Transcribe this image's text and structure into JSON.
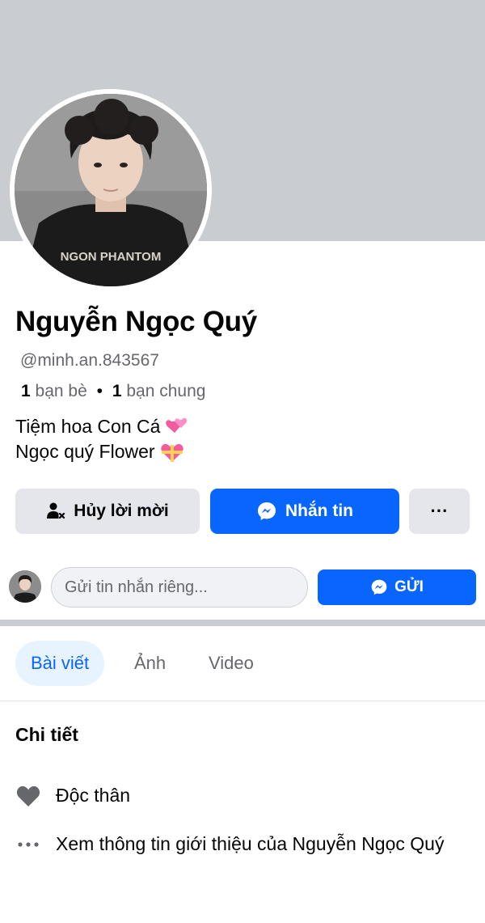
{
  "profile": {
    "name": "Nguyễn Ngọc Quý",
    "handle": "@minh.an.843567",
    "friends_count": "1",
    "friends_label": "bạn bè",
    "separator": "•",
    "mutual_count": "1",
    "mutual_label": "bạn chung",
    "bio_line1": "Tiệm hoa Con Cá",
    "bio_line2": "Ngọc quý Flower",
    "shirt_text": "NGON PHANTOM"
  },
  "actions": {
    "cancel_request": "Hủy lời mời",
    "message": "Nhắn tin",
    "more": "···"
  },
  "message_box": {
    "placeholder": "Gửi tin nhắn riêng...",
    "send": "GỬI"
  },
  "tabs": [
    {
      "label": "Bài viết",
      "active": true
    },
    {
      "label": "Ảnh",
      "active": false
    },
    {
      "label": "Video",
      "active": false
    }
  ],
  "details": {
    "title": "Chi tiết",
    "relationship": "Độc thân",
    "see_more": "Xem thông tin giới thiệu của Nguyễn Ngọc Quý"
  },
  "colors": {
    "accent": "#0866ff",
    "cover": "#c9ccd1",
    "grey_button": "#e4e6eb",
    "tab_active_bg": "#e7f3ff"
  },
  "icons": [
    "person-cancel-icon",
    "messenger-icon",
    "more-icon",
    "heart-icon",
    "ellipsis-icon",
    "heart-hearts-emoji",
    "gift-heart-emoji"
  ]
}
